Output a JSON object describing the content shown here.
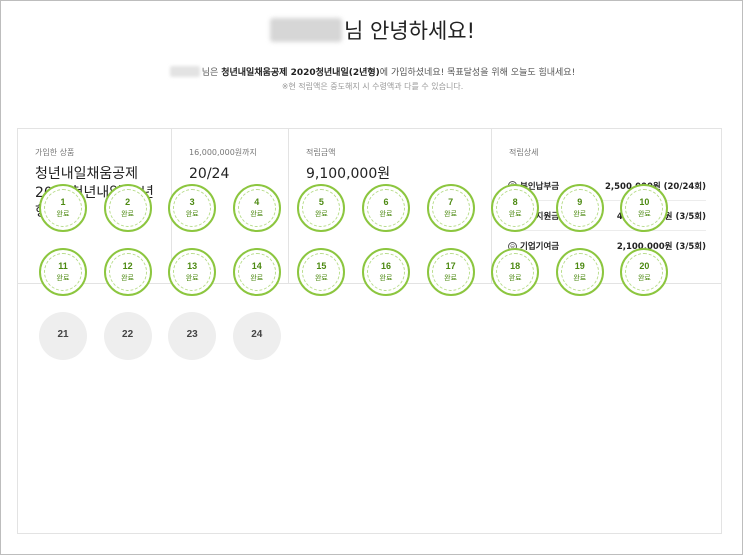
{
  "greeting": {
    "suffix": "님 안녕하세요!"
  },
  "sub": {
    "prefix": "님은 ",
    "product_bold": "청년내일채움공제 2020청년내일(2년형)",
    "suffix": "에 가입하셨네요! 목표달성을 위해 오늘도 힘내세요!"
  },
  "note": "※현 적립액은 중도해지 시 수령액과 다를 수 있습니다.",
  "info": {
    "product": {
      "label": "가입한 상품",
      "value": "청년내일채움공제 2020청년내일 (2년형)"
    },
    "count": {
      "label": "16,000,000원까지",
      "value": "20/24"
    },
    "amount": {
      "label": "적립금액",
      "value": "9,100,000원"
    },
    "detail": {
      "label": "적립상세",
      "items": [
        {
          "mark": "⊖",
          "name": "본인납부금",
          "amount": "2,500,000원 (20/24회)"
        },
        {
          "mark": "⊖",
          "name": "취업지원금",
          "amount": "4,500,000원 (3/5회)"
        },
        {
          "mark": "⊖",
          "name": "기업기여금",
          "amount": "2,100,000원 (3/5회)"
        }
      ]
    }
  },
  "payments": {
    "done_label": "완료",
    "items": [
      {
        "num": "1",
        "done": true
      },
      {
        "num": "2",
        "done": true
      },
      {
        "num": "3",
        "done": true
      },
      {
        "num": "4",
        "done": true
      },
      {
        "num": "5",
        "done": true
      },
      {
        "num": "6",
        "done": true
      },
      {
        "num": "7",
        "done": true
      },
      {
        "num": "8",
        "done": true
      },
      {
        "num": "9",
        "done": true
      },
      {
        "num": "10",
        "done": true
      },
      {
        "num": "11",
        "done": true
      },
      {
        "num": "12",
        "done": true
      },
      {
        "num": "13",
        "done": true
      },
      {
        "num": "14",
        "done": true
      },
      {
        "num": "15",
        "done": true
      },
      {
        "num": "16",
        "done": true
      },
      {
        "num": "17",
        "done": true
      },
      {
        "num": "18",
        "done": true
      },
      {
        "num": "19",
        "done": true
      },
      {
        "num": "20",
        "done": true
      },
      {
        "num": "21",
        "done": false
      },
      {
        "num": "22",
        "done": false
      },
      {
        "num": "23",
        "done": false
      },
      {
        "num": "24",
        "done": false
      }
    ]
  },
  "colors": {
    "accent_green": "#8cc63f",
    "todo_gray": "#eeeeee"
  }
}
